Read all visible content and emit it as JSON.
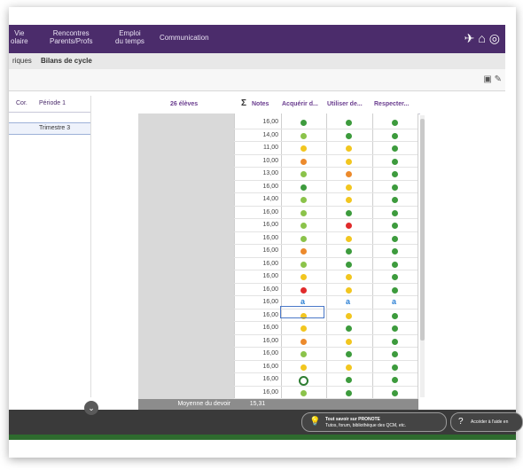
{
  "navbar": {
    "items": [
      {
        "label_top": "Vie",
        "label_bottom": "olaire"
      },
      {
        "label_top": "Rencontres",
        "label_bottom": "Parents/Profs"
      },
      {
        "label_top": "Emploi",
        "label_bottom": "du temps"
      }
    ],
    "communication": "Communication"
  },
  "subnav": {
    "items": [
      "riques",
      "Bilans de cycle"
    ]
  },
  "left_panel": {
    "col_cor": "Cor.",
    "col_periode": "Période 1",
    "periode_value": "Trimestre 3"
  },
  "grid": {
    "student_header": "26 élèves",
    "notes_header": "Notes",
    "columns": [
      "Acquérir d...",
      "Utiliser de...",
      "Respecter..."
    ],
    "colors": {
      "green": "#3d9b3d",
      "lightgreen": "#8bc34a",
      "yellow": "#f2c61f",
      "orange": "#ec8a2c",
      "red": "#e02b2b",
      "blue": "#2a7fd4"
    },
    "rows": [
      {
        "note": "16,00",
        "marks": [
          "green",
          "green",
          "green"
        ]
      },
      {
        "note": "14,00",
        "marks": [
          "lightgreen",
          "green",
          "green"
        ]
      },
      {
        "note": "11,00",
        "marks": [
          "yellow",
          "yellow",
          "green"
        ]
      },
      {
        "note": "10,00",
        "marks": [
          "orange",
          "yellow",
          "green"
        ]
      },
      {
        "note": "13,00",
        "marks": [
          "lightgreen",
          "orange",
          "green"
        ]
      },
      {
        "note": "16,00",
        "marks": [
          "green",
          "yellow",
          "green"
        ]
      },
      {
        "note": "14,00",
        "marks": [
          "lightgreen",
          "yellow",
          "green"
        ]
      },
      {
        "note": "16,00",
        "marks": [
          "lightgreen",
          "green",
          "green"
        ]
      },
      {
        "note": "16,00",
        "marks": [
          "lightgreen",
          "red",
          "green"
        ]
      },
      {
        "note": "16,00",
        "marks": [
          "lightgreen",
          "yellow",
          "green"
        ]
      },
      {
        "note": "16,00",
        "marks": [
          "orange",
          "green",
          "green"
        ]
      },
      {
        "note": "16,00",
        "marks": [
          "lightgreen",
          "green",
          "green"
        ]
      },
      {
        "note": "16,00",
        "marks": [
          "yellow",
          "yellow",
          "green"
        ]
      },
      {
        "note": "16,00",
        "marks": [
          "red",
          "yellow",
          "green"
        ]
      },
      {
        "note": "16,00",
        "marks": [
          "a",
          "a",
          "a"
        ]
      },
      {
        "note": "16,00",
        "marks": [
          "yellow",
          "yellow",
          "green"
        ]
      },
      {
        "note": "16,00",
        "marks": [
          "yellow",
          "green",
          "green"
        ]
      },
      {
        "note": "16,00",
        "marks": [
          "orange",
          "yellow",
          "green"
        ]
      },
      {
        "note": "16,00",
        "marks": [
          "lightgreen",
          "green",
          "green"
        ]
      },
      {
        "note": "16,00",
        "marks": [
          "yellow",
          "yellow",
          "green"
        ]
      },
      {
        "note": "16,00",
        "marks": [
          "ring",
          "green",
          "green"
        ]
      },
      {
        "note": "16,00",
        "marks": [
          "lightgreen",
          "green",
          "green"
        ]
      }
    ],
    "footer_label": "Moyenne du devoir",
    "footer_value": "15,31"
  },
  "bottom": {
    "pill1_title": "Tout savoir sur PRONOTE",
    "pill1_sub": "Tutos, forum, bibliothèque des QCM, etc.",
    "pill2": "Accéder à l'aide en"
  }
}
